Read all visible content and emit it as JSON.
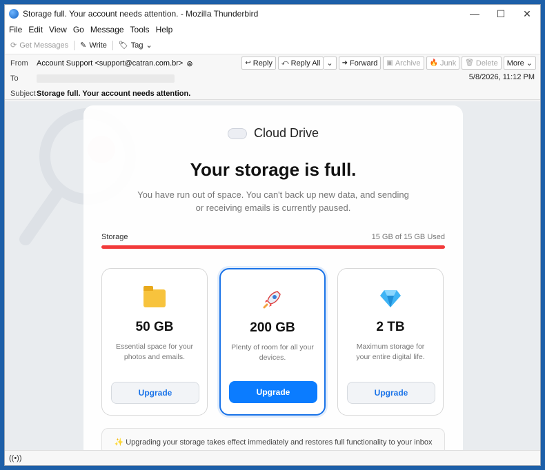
{
  "window": {
    "title": "Storage full. Your account needs attention. - Mozilla Thunderbird",
    "minimize_icon": "minimize-icon",
    "maximize_icon": "maximize-icon",
    "close_icon": "close-icon"
  },
  "menu": [
    "File",
    "Edit",
    "View",
    "Go",
    "Message",
    "Tools",
    "Help"
  ],
  "toolbar": {
    "get_messages": "Get Messages",
    "write": "Write",
    "tag": "Tag"
  },
  "header": {
    "from_label": "From",
    "from_value": "Account Support <support@catran.com.br>",
    "to_label": "To",
    "subject_label": "Subject",
    "subject_value": "Storage full. Your account needs attention.",
    "date": "5/8/2026, 11:12 PM"
  },
  "actions": {
    "reply": "Reply",
    "reply_all": "Reply All",
    "forward": "Forward",
    "archive": "Archive",
    "junk": "Junk",
    "delete": "Delete",
    "more": "More"
  },
  "email": {
    "brand": "Cloud Drive",
    "headline": "Your storage is full.",
    "subtext": "You have run out of space. You can't back up new data, and sending or receiving emails is currently paused.",
    "storage_label": "Storage",
    "storage_used": "15 GB of 15 GB Used",
    "storage_fraction": 1.0,
    "plans": [
      {
        "size": "50 GB",
        "desc": "Essential space for your photos and emails.",
        "button": "Upgrade",
        "icon": "folder-icon"
      },
      {
        "size": "200 GB",
        "desc": "Plenty of room for all your devices.",
        "button": "Upgrade",
        "icon": "rocket-icon"
      },
      {
        "size": "2 TB",
        "desc": "Maximum storage for your entire digital life.",
        "button": "Upgrade",
        "icon": "diamond-icon"
      }
    ],
    "note": "✨ Upgrading your storage takes effect immediately and restores full functionality to your inbox"
  },
  "colors": {
    "accent": "#1a73e8",
    "cta": "#0b7cff",
    "storage_bar": "#f23a3a"
  }
}
